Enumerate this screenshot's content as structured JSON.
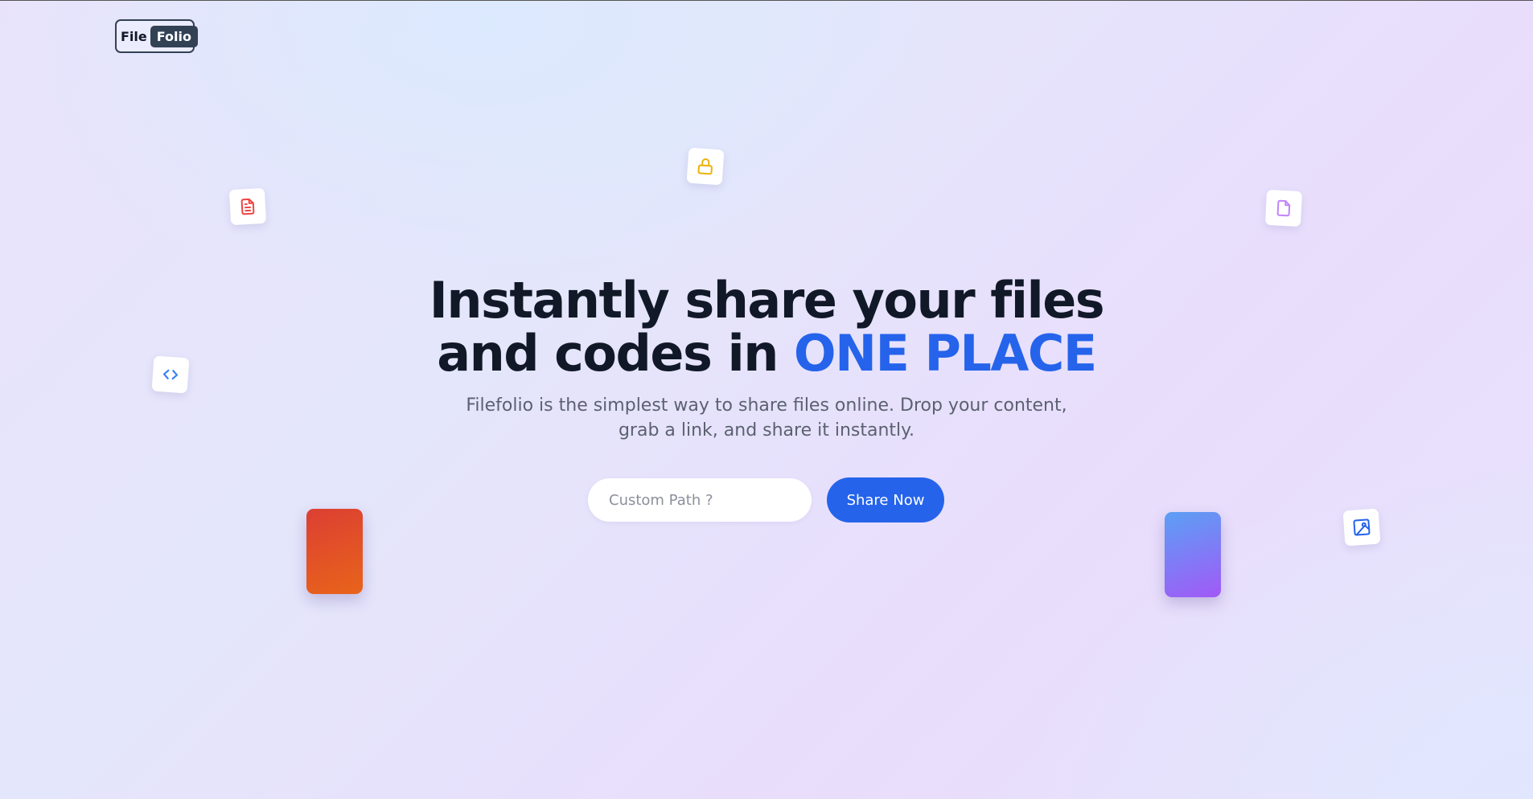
{
  "logo": {
    "part1": "File",
    "part2": "Folio"
  },
  "hero": {
    "headline_line1": "Instantly share your files",
    "headline_line2_prefix": "and codes in ",
    "headline_accent": "ONE PLACE",
    "subtitle": "Filefolio is the simplest way to share files online. Drop your content, grab a link, and share it instantly."
  },
  "form": {
    "path_placeholder": "Custom Path ?",
    "path_value": "",
    "share_label": "Share Now"
  },
  "icons": {
    "document": "document-text-icon",
    "lock": "lock-icon",
    "file": "file-icon",
    "code": "code-icon",
    "image": "image-icon"
  },
  "colors": {
    "accent": "#2563eb",
    "headline": "#111827",
    "logo_dark": "#334155",
    "document_icon": "#ef4444",
    "lock_icon": "#eab308",
    "file_icon": "#c084fc",
    "code_icon": "#3b82f6",
    "image_icon": "#2563eb"
  }
}
